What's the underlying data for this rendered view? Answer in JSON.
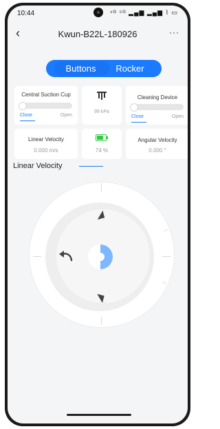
{
  "status_bar": {
    "time": "10:44",
    "icons": "⁴ᴳ ⁵ᴳ ▂▄▆ ▂▄▆ ⌇ ▭"
  },
  "nav": {
    "back_glyph": "‹",
    "title": "Kwun-B22L-180926",
    "more_glyph": "···"
  },
  "segmented": {
    "tabs": [
      "Buttons",
      "Rocker"
    ],
    "active": "Buttons"
  },
  "cards": {
    "suction": {
      "label": "Central Suction Cup",
      "close": "Close",
      "open": "Open",
      "selected": "Close"
    },
    "pressure": {
      "icon": "pressure-icon",
      "value": "99 kPa"
    },
    "cleaning": {
      "label": "Cleaning Device",
      "close": "Close",
      "open": "Open",
      "selected": "Close"
    },
    "linear_velocity": {
      "label": "Linear Velocity",
      "value": "0.000 m/s"
    },
    "battery": {
      "icon": "battery-icon",
      "value": "74 %",
      "level": 0.74
    },
    "angular_velocity": {
      "label": "Angular Velocity",
      "value": "0.000 °"
    }
  },
  "chart_section": {
    "title": "Linear Velocity"
  },
  "colors": {
    "accent": "#1a7bff",
    "battery": "#2ecc40"
  }
}
